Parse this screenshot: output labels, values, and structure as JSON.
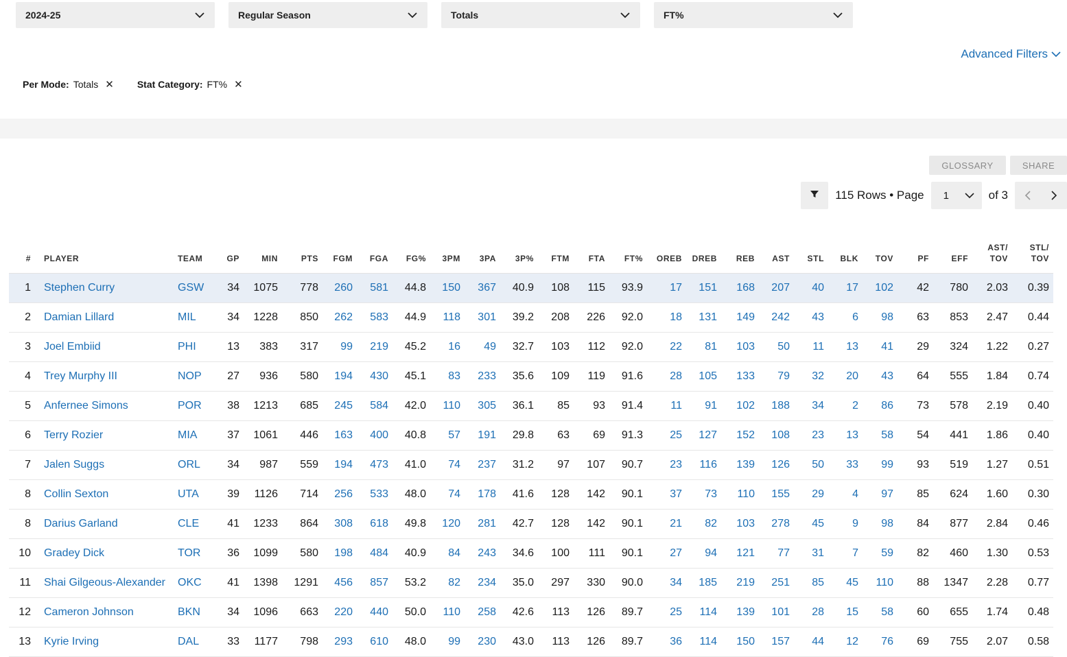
{
  "filters": [
    {
      "value": "2024-25"
    },
    {
      "value": "Regular Season"
    },
    {
      "value": "Totals"
    },
    {
      "value": "FT%"
    }
  ],
  "advanced_filters": "Advanced Filters",
  "chips": [
    {
      "label": "Per Mode:",
      "value": "Totals"
    },
    {
      "label": "Stat Category:",
      "value": "FT%"
    }
  ],
  "buttons": {
    "glossary": "GLOSSARY",
    "share": "SHARE"
  },
  "pager": {
    "rows_text": "115 Rows • Page",
    "page": "1",
    "of_text": "of 3"
  },
  "columns": [
    "#",
    "PLAYER",
    "TEAM",
    "GP",
    "MIN",
    "PTS",
    "FGM",
    "FGA",
    "FG%",
    "3PM",
    "3PA",
    "3P%",
    "FTM",
    "FTA",
    "FT%",
    "OREB",
    "DREB",
    "REB",
    "AST",
    "STL",
    "BLK",
    "TOV",
    "PF",
    "EFF",
    "AST/ TOV",
    "STL/ TOV"
  ],
  "rows": [
    [
      "1",
      "Stephen Curry",
      "GSW",
      "34",
      "1075",
      "778",
      "260",
      "581",
      "44.8",
      "150",
      "367",
      "40.9",
      "108",
      "115",
      "93.9",
      "17",
      "151",
      "168",
      "207",
      "40",
      "17",
      "102",
      "42",
      "780",
      "2.03",
      "0.39"
    ],
    [
      "2",
      "Damian Lillard",
      "MIL",
      "34",
      "1228",
      "850",
      "262",
      "583",
      "44.9",
      "118",
      "301",
      "39.2",
      "208",
      "226",
      "92.0",
      "18",
      "131",
      "149",
      "242",
      "43",
      "6",
      "98",
      "63",
      "853",
      "2.47",
      "0.44"
    ],
    [
      "3",
      "Joel Embiid",
      "PHI",
      "13",
      "383",
      "317",
      "99",
      "219",
      "45.2",
      "16",
      "49",
      "32.7",
      "103",
      "112",
      "92.0",
      "22",
      "81",
      "103",
      "50",
      "11",
      "13",
      "41",
      "29",
      "324",
      "1.22",
      "0.27"
    ],
    [
      "4",
      "Trey Murphy III",
      "NOP",
      "27",
      "936",
      "580",
      "194",
      "430",
      "45.1",
      "83",
      "233",
      "35.6",
      "109",
      "119",
      "91.6",
      "28",
      "105",
      "133",
      "79",
      "32",
      "20",
      "43",
      "64",
      "555",
      "1.84",
      "0.74"
    ],
    [
      "5",
      "Anfernee Simons",
      "POR",
      "38",
      "1213",
      "685",
      "245",
      "584",
      "42.0",
      "110",
      "305",
      "36.1",
      "85",
      "93",
      "91.4",
      "11",
      "91",
      "102",
      "188",
      "34",
      "2",
      "86",
      "73",
      "578",
      "2.19",
      "0.40"
    ],
    [
      "6",
      "Terry Rozier",
      "MIA",
      "37",
      "1061",
      "446",
      "163",
      "400",
      "40.8",
      "57",
      "191",
      "29.8",
      "63",
      "69",
      "91.3",
      "25",
      "127",
      "152",
      "108",
      "23",
      "13",
      "58",
      "54",
      "441",
      "1.86",
      "0.40"
    ],
    [
      "7",
      "Jalen Suggs",
      "ORL",
      "34",
      "987",
      "559",
      "194",
      "473",
      "41.0",
      "74",
      "237",
      "31.2",
      "97",
      "107",
      "90.7",
      "23",
      "116",
      "139",
      "126",
      "50",
      "33",
      "99",
      "93",
      "519",
      "1.27",
      "0.51"
    ],
    [
      "8",
      "Collin Sexton",
      "UTA",
      "39",
      "1126",
      "714",
      "256",
      "533",
      "48.0",
      "74",
      "178",
      "41.6",
      "128",
      "142",
      "90.1",
      "37",
      "73",
      "110",
      "155",
      "29",
      "4",
      "97",
      "85",
      "624",
      "1.60",
      "0.30"
    ],
    [
      "8",
      "Darius Garland",
      "CLE",
      "41",
      "1233",
      "864",
      "308",
      "618",
      "49.8",
      "120",
      "281",
      "42.7",
      "128",
      "142",
      "90.1",
      "21",
      "82",
      "103",
      "278",
      "45",
      "9",
      "98",
      "84",
      "877",
      "2.84",
      "0.46"
    ],
    [
      "10",
      "Gradey Dick",
      "TOR",
      "36",
      "1099",
      "580",
      "198",
      "484",
      "40.9",
      "84",
      "243",
      "34.6",
      "100",
      "111",
      "90.1",
      "27",
      "94",
      "121",
      "77",
      "31",
      "7",
      "59",
      "82",
      "460",
      "1.30",
      "0.53"
    ],
    [
      "11",
      "Shai Gilgeous-Alexander",
      "OKC",
      "41",
      "1398",
      "1291",
      "456",
      "857",
      "53.2",
      "82",
      "234",
      "35.0",
      "297",
      "330",
      "90.0",
      "34",
      "185",
      "219",
      "251",
      "85",
      "45",
      "110",
      "88",
      "1347",
      "2.28",
      "0.77"
    ],
    [
      "12",
      "Cameron Johnson",
      "BKN",
      "34",
      "1096",
      "663",
      "220",
      "440",
      "50.0",
      "110",
      "258",
      "42.6",
      "113",
      "126",
      "89.7",
      "25",
      "114",
      "139",
      "101",
      "28",
      "15",
      "58",
      "60",
      "655",
      "1.74",
      "0.48"
    ],
    [
      "13",
      "Kyrie Irving",
      "DAL",
      "33",
      "1177",
      "798",
      "293",
      "610",
      "48.0",
      "99",
      "230",
      "43.0",
      "113",
      "126",
      "89.7",
      "36",
      "114",
      "150",
      "157",
      "44",
      "12",
      "76",
      "69",
      "755",
      "2.07",
      "0.58"
    ]
  ],
  "colors": {
    "link": "#1d6fb5",
    "highlight_row": "#e8eef6",
    "control_bg": "#eeeeee"
  },
  "icons": [
    "chevron-down-icon",
    "close-icon",
    "filter-icon",
    "chevron-left-icon",
    "chevron-right-icon"
  ]
}
